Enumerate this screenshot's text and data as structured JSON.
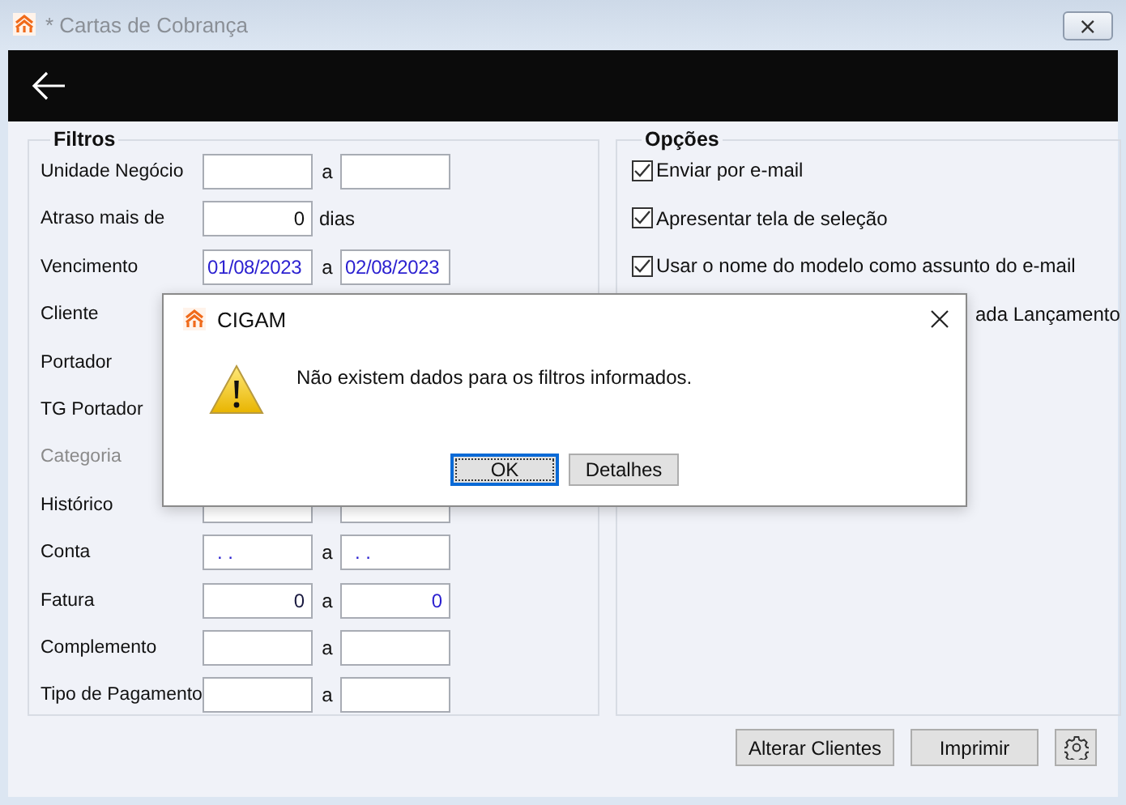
{
  "window": {
    "title": "* Cartas de Cobrança",
    "close_label": "⨯"
  },
  "filters": {
    "title": "Filtros",
    "rows": [
      {
        "label": "Unidade Negócio",
        "disabled": false,
        "from": {
          "kind": "text"
        },
        "sep": "a",
        "to": {
          "kind": "text"
        }
      },
      {
        "label": "Atraso mais de",
        "disabled": false,
        "from": {
          "kind": "number",
          "value": "0"
        },
        "sep": "dias"
      },
      {
        "label": "Vencimento",
        "disabled": false,
        "from": {
          "kind": "date",
          "value": "01/08/2023",
          "color": "#2a1fd0"
        },
        "sep": "a",
        "to": {
          "kind": "date",
          "value": "02/08/2023",
          "color": "#2a1fd0"
        }
      },
      {
        "label": "Cliente",
        "disabled": false
      },
      {
        "label": "Portador",
        "disabled": false
      },
      {
        "label": "TG Portador",
        "disabled": false
      },
      {
        "label": "Categoria",
        "disabled": true
      },
      {
        "label": "Histórico",
        "disabled": false,
        "from": {
          "kind": "text"
        },
        "to": {
          "kind": "text"
        }
      },
      {
        "label": "Conta",
        "disabled": false,
        "from": {
          "kind": "text",
          "value": ". .",
          "color": "#2a1fd0"
        },
        "sep": "a",
        "to": {
          "kind": "text",
          "value": ". .",
          "color": "#2a1fd0"
        }
      },
      {
        "label": "Fatura",
        "disabled": false,
        "from": {
          "kind": "number",
          "value": "0",
          "color": "#1a1a40"
        },
        "sep": "a",
        "to": {
          "kind": "number",
          "value": "0",
          "color": "#2a1fd0"
        }
      },
      {
        "label": "Complemento",
        "disabled": false,
        "from": {
          "kind": "text"
        },
        "sep": "a",
        "to": {
          "kind": "text"
        }
      },
      {
        "label": "Tipo de Pagamento",
        "disabled": false,
        "from": {
          "kind": "text"
        },
        "sep": "a",
        "to": {
          "kind": "text"
        }
      }
    ]
  },
  "options": {
    "title": "Opções",
    "items": [
      {
        "kind": "checkbox",
        "label": "Enviar por e-mail",
        "checked": true
      },
      {
        "kind": "checkbox",
        "label": "Apresentar tela de seleção",
        "checked": true
      },
      {
        "kind": "checkbox",
        "label": "Usar o nome do modelo como assunto do e-mail",
        "checked": true
      },
      {
        "kind": "cut",
        "label": "ada Lançamento"
      }
    ]
  },
  "buttons": [
    {
      "kind": "text",
      "label": "Alterar Clientes"
    },
    {
      "kind": "text",
      "label": "Imprimir"
    },
    {
      "kind": "gear"
    }
  ],
  "dialog": {
    "title": "CIGAM",
    "message": "Não existem dados para os filtros informados.",
    "buttons": [
      {
        "label": "OK",
        "selected": true
      },
      {
        "label": "Detalhes",
        "selected": false
      }
    ]
  }
}
